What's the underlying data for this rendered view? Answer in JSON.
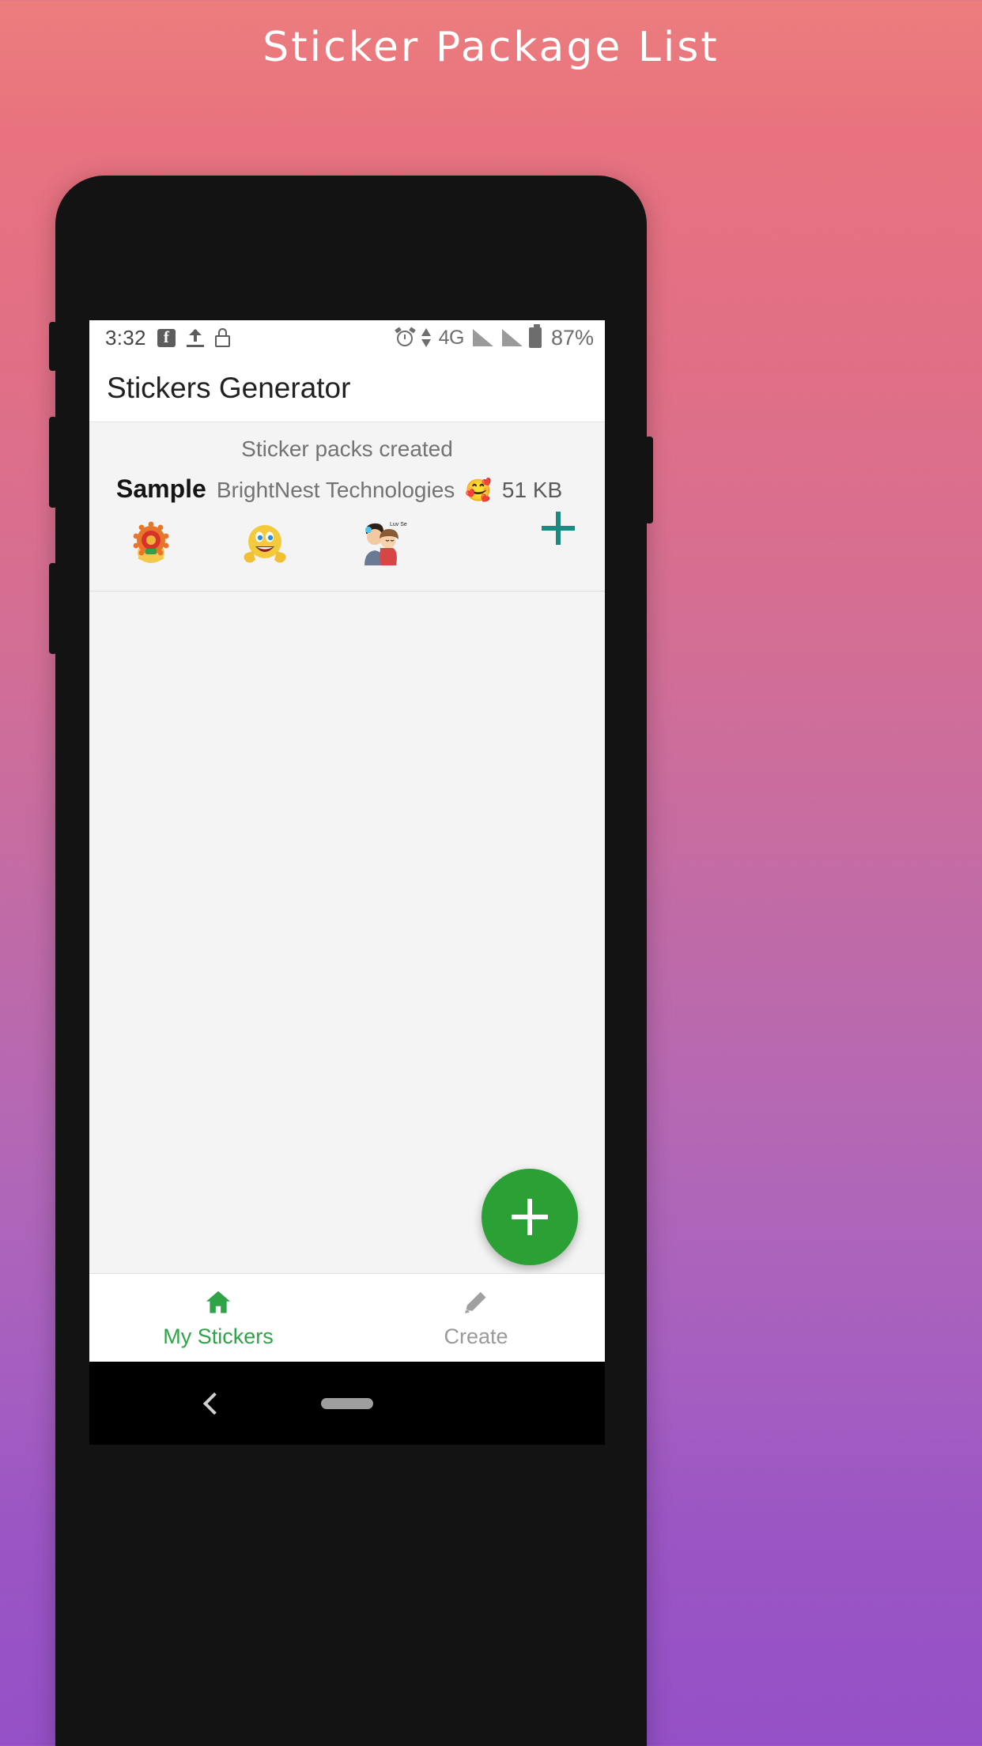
{
  "page": {
    "title": "Sticker Package List",
    "background_gradient_from": "#ec7d7d",
    "background_gradient_to": "#9450c6"
  },
  "statusbar": {
    "time": "3:32",
    "icons_left": [
      "facebook-icon",
      "upload-icon",
      "lock-icon"
    ],
    "alarm_icon": "alarm-clock-icon",
    "data_arrows_icon": "data-transfer-icon",
    "network_type": "4G",
    "signal_icons": [
      "signal-bars-sim1",
      "signal-bars-sim2"
    ],
    "battery_icon": "battery-icon",
    "battery_percent": "87%"
  },
  "appbar": {
    "title": "Stickers Generator"
  },
  "content": {
    "section_header": "Sticker packs created",
    "pack": {
      "name": "Sample",
      "publisher": "BrightNest Technologies",
      "emoji": "🥰",
      "size": "51 KB",
      "stickers": [
        {
          "name": "sticker-thumbnail-ornament",
          "alt": "decorative orange ornament sticker"
        },
        {
          "name": "sticker-thumbnail-smiley-thumbs-up",
          "alt": "yellow smiley with thumbs up"
        },
        {
          "name": "sticker-thumbnail-couple",
          "alt": "cartoon couple sticker",
          "caption": "Luv Self"
        }
      ],
      "add_button": "add-sticker-pack-plus",
      "add_button_color": "#1b8a80"
    }
  },
  "fab": {
    "name": "create-sticker-pack-fab",
    "icon": "plus-icon",
    "color": "#2ba035"
  },
  "bottomnav": {
    "items": [
      {
        "label": "My Stickers",
        "icon": "home-icon",
        "active": true,
        "color": "#2ea347"
      },
      {
        "label": "Create",
        "icon": "pencil-icon",
        "active": false,
        "color": "#9a9a9a"
      }
    ]
  },
  "androidnav": {
    "back_icon": "back-chevron-icon",
    "home_pill": "home-pill-indicator"
  }
}
